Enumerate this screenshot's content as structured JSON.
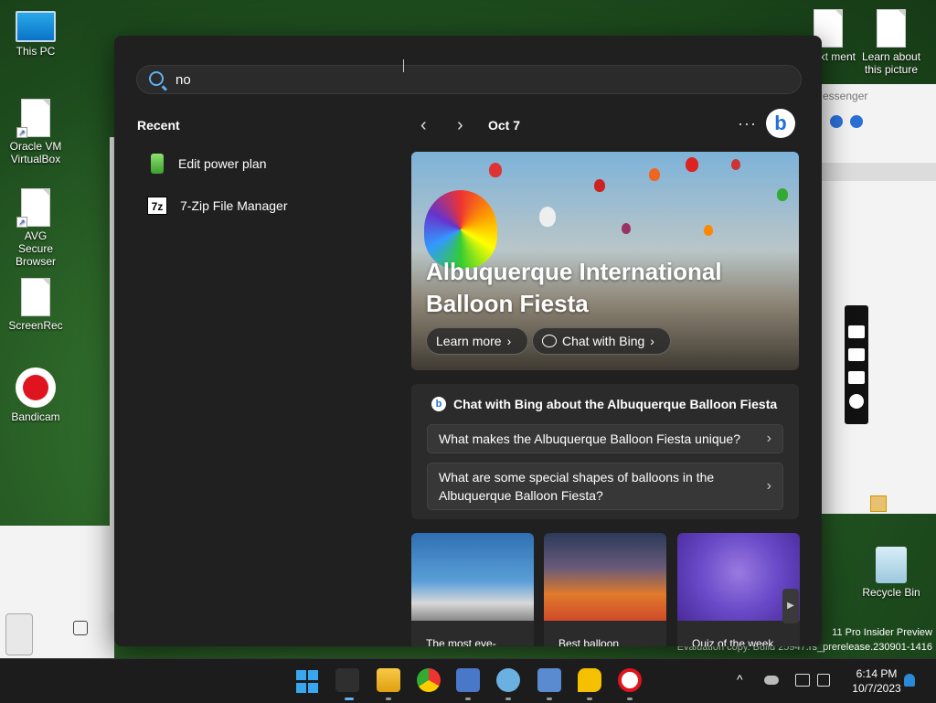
{
  "desktop": {
    "icons": [
      {
        "label": "This PC"
      },
      {
        "label": "Oracle VM VirtualBox"
      },
      {
        "label": "AVG Secure Browser"
      },
      {
        "label": "ScreenRec"
      },
      {
        "label": "Bandicam"
      },
      {
        "label": "Text ment"
      },
      {
        "label": "Learn about this picture"
      },
      {
        "label": "Recycle Bin"
      }
    ],
    "watermark_line1": "11 Pro Insider Preview",
    "watermark_line2": "Evaluation copy. Build 25947.rs_prerelease.230901-1416"
  },
  "messenger": {
    "title": "essenger"
  },
  "search": {
    "query": "no",
    "recent_title": "Recent",
    "recent_items": [
      {
        "label": "Edit power plan",
        "icon": "battery-icon"
      },
      {
        "label": "7-Zip File Manager",
        "icon": "7zip-icon",
        "icon_text": "7z"
      }
    ],
    "date": "Oct 7",
    "more_label": "···",
    "bing_letter": "b",
    "hero": {
      "title": "Albuquerque International Balloon Fiesta",
      "learn_more": "Learn more",
      "chat_with_bing": "Chat with Bing"
    },
    "chat_card": {
      "title": "Chat with Bing about the Albuquerque Balloon Fiesta",
      "questions": [
        "What makes the Albuquerque Balloon Fiesta unique?",
        "What are some special shapes of balloons in the Albuquerque Balloon Fiesta?"
      ]
    },
    "thumbnails": [
      {
        "caption": "The most eye-"
      },
      {
        "caption": "Best balloon"
      },
      {
        "caption": "Quiz of the week"
      }
    ]
  },
  "taskbar": {
    "time": "6:14 PM",
    "date": "10/7/2023",
    "tray_up": "^"
  }
}
